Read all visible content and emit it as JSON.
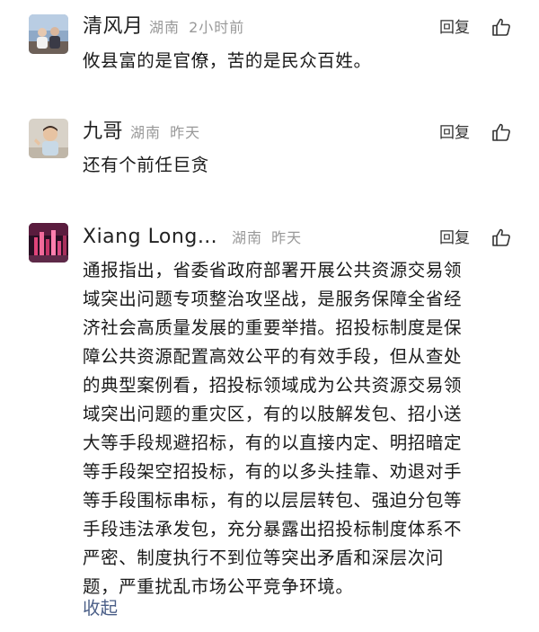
{
  "comments": [
    {
      "username": "清风月",
      "location": "湖南",
      "time": "2小时前",
      "reply_label": "回复",
      "text": "攸县富的是官僚，苦的是民众百姓。"
    },
    {
      "username": "九哥",
      "location": "湖南",
      "time": "昨天",
      "reply_label": "回复",
      "text": "还有个前任巨贪"
    },
    {
      "username": "Xiang  Long…",
      "location": "湖南",
      "time": "昨天",
      "reply_label": "回复",
      "text_lines": [
        "通报指出，省委省政府部署开展公共资源交易领",
        "域突出问题专项整治攻坚战，是服务保障全省经",
        "济社会高质量发展的重要举措。招投标制度是保",
        "障公共资源配置高效公平的有效手段，但从查处",
        "的典型案例看，招投标领域成为公共资源交易领",
        "域突出问题的重灾区，有的以肢解发包、招小送",
        "大等手段规避招标，有的以直接内定、明招暗定",
        "等手段架空招投标，有的以多头挂靠、劝退对手",
        "等手段围标串标，有的以层层转包、强迫分包等",
        "手段违法承发包，充分暴露出招投标制度体系不",
        "严密、制度执行不到位等突出矛盾和深层次问",
        "题，严重扰乱市场公平竞争环境。"
      ],
      "collapse_label": "收起"
    }
  ],
  "icons": {
    "like": "thumbs-up-icon"
  }
}
